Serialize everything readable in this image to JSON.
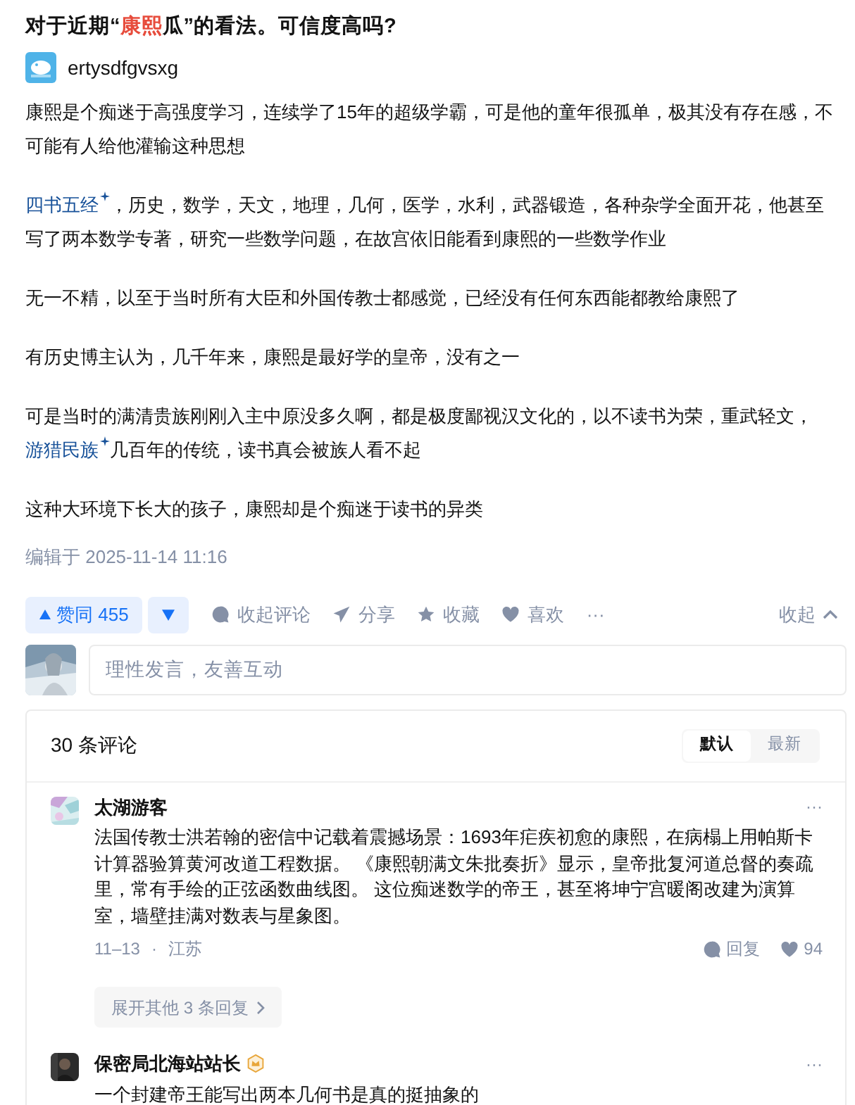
{
  "title": [
    {
      "text": "对于近期“",
      "highlight": false
    },
    {
      "text": "康熙",
      "highlight": true
    },
    {
      "text": "瓜”的看法。可信度高吗?",
      "highlight": false
    }
  ],
  "author": {
    "name": "ertysdfgvsxg"
  },
  "paragraphs": [
    [
      {
        "text": "康熙是个痴迷于高强度学习，连续学了15年的超级学霸，可是他的童年很孤单，极其没有存在感，不可能有人给他灌输这种思想",
        "link": false
      }
    ],
    [
      {
        "text": "四书五经",
        "link": true
      },
      {
        "text": "，历史，数学，天文，地理，几何，医学，水利，武器锻造，各种杂学全面开花，他甚至写了两本数学专著，研究一些数学问题，在故宫依旧能看到康熙的一些数学作业",
        "link": false
      }
    ],
    [
      {
        "text": "无一不精，以至于当时所有大臣和外国传教士都感觉，已经没有任何东西能都教给康熙了",
        "link": false
      }
    ],
    [
      {
        "text": "有历史博主认为，几千年来，康熙是最好学的皇帝，没有之一",
        "link": false
      }
    ],
    [
      {
        "text": "可是当时的满清贵族刚刚入主中原没多久啊，都是极度鄙视汉文化的，以不读书为荣，重武轻文，",
        "link": false
      },
      {
        "text": "游猎民族",
        "link": true
      },
      {
        "text": "几百年的传统，读书真会被族人看不起",
        "link": false
      }
    ],
    [
      {
        "text": "这种大环境下长大的孩子，康熙却是个痴迷于读书的异类",
        "link": false
      }
    ]
  ],
  "edited": "编辑于 2025-11-14 11:16",
  "actions": {
    "upvote": {
      "label": "赞同 455",
      "selected": false
    },
    "items": [
      {
        "kind": "comment",
        "label": "收起评论"
      },
      {
        "kind": "share",
        "label": "分享"
      },
      {
        "kind": "star",
        "label": "收藏"
      },
      {
        "kind": "heart",
        "label": "喜欢"
      },
      {
        "kind": "more",
        "label": "···"
      }
    ],
    "collapse": "收起"
  },
  "comment_input": {
    "placeholder": "理性发言，友善互动"
  },
  "comments_panel": {
    "count": "30 条评论",
    "sort_tabs": [
      {
        "label": "默认",
        "selected": true
      },
      {
        "label": "最新",
        "selected": false
      }
    ],
    "comments": [
      {
        "author": "太湖游客",
        "badge": false,
        "more": "···",
        "text": "法国传教士洪若翰的密信中记载着震撼场景：1693年疟疾初愈的康熙，在病榻上用帕斯卡计算器验算黄河改道工程数据。 《康熙朝满文朱批奏折》显示，皇帝批复河道总督的奏疏里，常有手绘的正弦函数曲线图。 这位痴迷数学的帝王，甚至将坤宁宫暖阁改建为演算室，墙壁挂满对数表与星象图。",
        "date": "11–13",
        "separator": "·",
        "location": "江苏",
        "reply": "回复",
        "likes": "94",
        "expand": "展开其他 3 条回复"
      },
      {
        "author": "保密局北海站站长",
        "badge": true,
        "more": "···",
        "text": "一个封建帝王能写出两本几何书是真的挺抽象的"
      }
    ]
  }
}
